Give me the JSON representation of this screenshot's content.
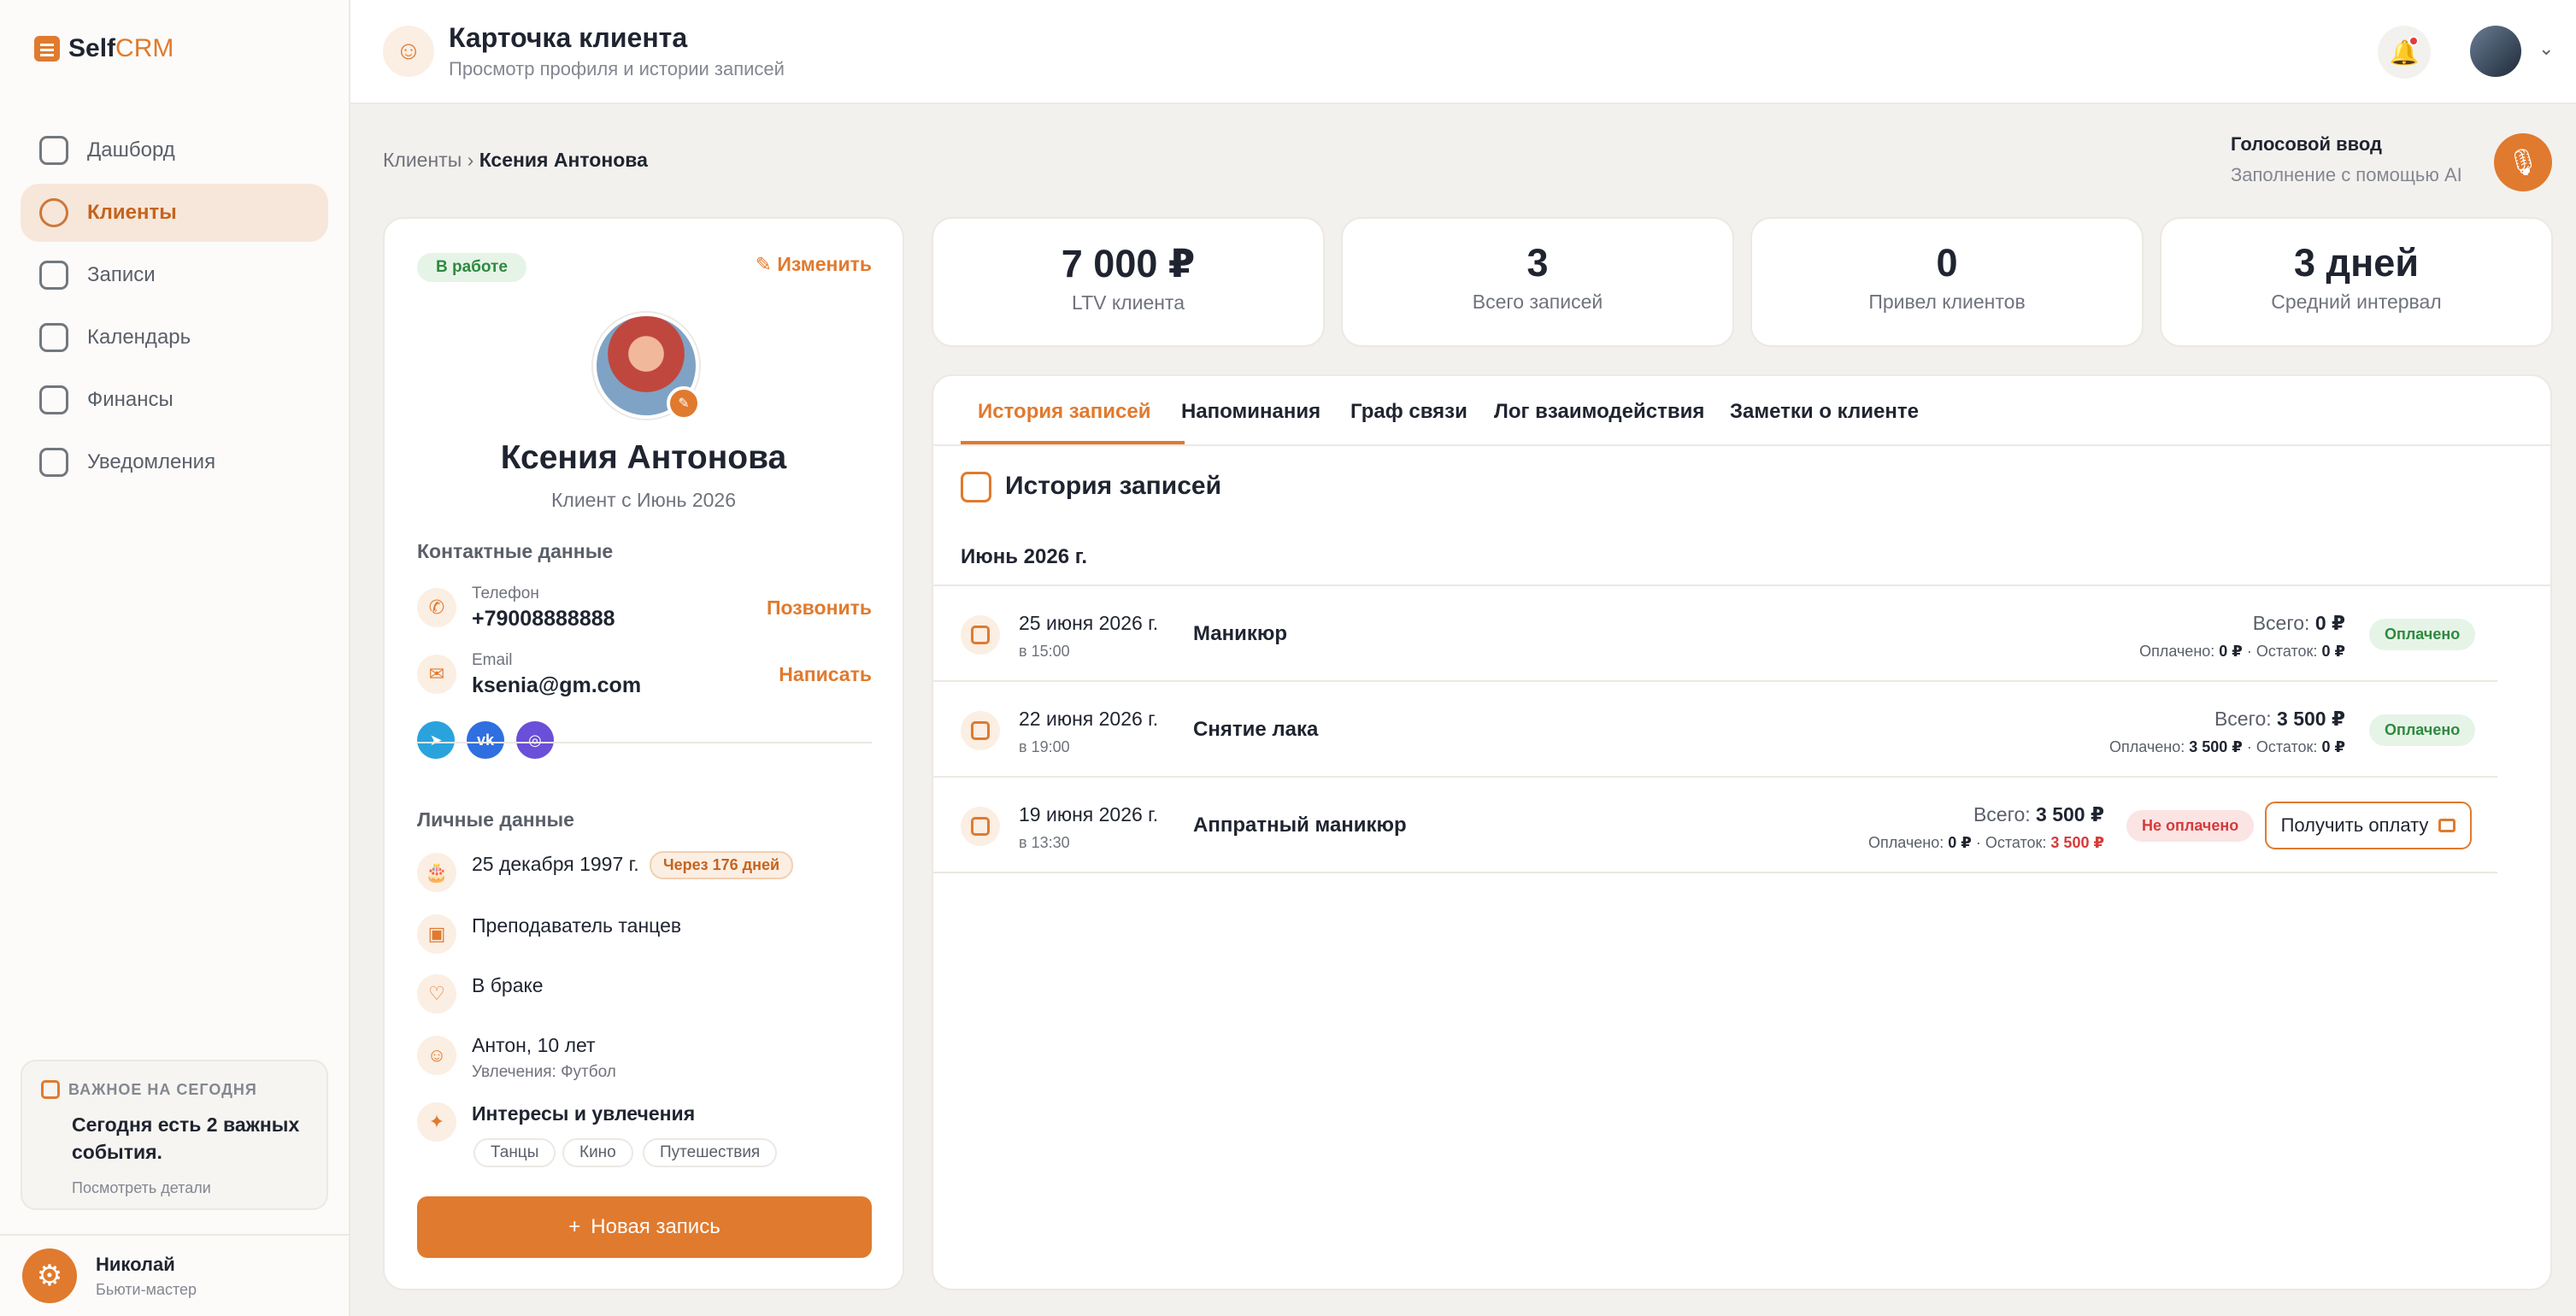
{
  "app": {
    "logo_self": "Self",
    "logo_crm": "CRM"
  },
  "sidebar": {
    "items": [
      {
        "label": "Дашборд"
      },
      {
        "label": "Клиенты"
      },
      {
        "label": "Записи"
      },
      {
        "label": "Календарь"
      },
      {
        "label": "Финансы"
      },
      {
        "label": "Уведомления"
      }
    ],
    "today": {
      "heading": "ВАЖНОЕ НА СЕГОДНЯ",
      "text": "Сегодня есть 2 важных события.",
      "link": "Посмотреть детали"
    },
    "user": {
      "name": "Николай",
      "role": "Бьюти-мастер"
    }
  },
  "header": {
    "title": "Карточка клиента",
    "subtitle": "Просмотр профиля и истории записей"
  },
  "breadcrumb": {
    "parent": "Клиенты",
    "separator": "›",
    "current": "Ксения Антонова"
  },
  "voice": {
    "title": "Голосовой ввод",
    "subtitle": "Заполнение с помощью AI"
  },
  "profile": {
    "status": "В работе",
    "edit": "Изменить",
    "name": "Ксения Антонова",
    "since": "Клиент с Июнь 2026",
    "contacts_title": "Контактные данные",
    "phone_label": "Телефон",
    "phone": "+79008888888",
    "call": "Позвонить",
    "email_label": "Email",
    "email": "ksenia@gm.com",
    "write": "Написать",
    "personal_title": "Личные данные",
    "birthday": "25 декабря 1997 г.",
    "birthday_badge": "Через 176 дней",
    "job": "Преподаватель танцев",
    "family": "В браке",
    "child": "Антон, 10 лет",
    "child_hobby": "Увлечения: Футбол",
    "interests_title": "Интересы и увлечения",
    "tags": [
      "Танцы",
      "Кино",
      "Путешествия"
    ],
    "new_record": "Новая запись"
  },
  "stats": [
    {
      "value": "7 000 ₽",
      "label": "LTV клиента"
    },
    {
      "value": "3",
      "label": "Всего записей"
    },
    {
      "value": "0",
      "label": "Привел клиентов"
    },
    {
      "value": "3 дней",
      "label": "Средний интервал"
    }
  ],
  "tabs": [
    "История записей",
    "Напоминания",
    "Граф связи",
    "Лог взаимодействия",
    "Заметки о клиенте"
  ],
  "history": {
    "title": "История записей",
    "month": "Июнь 2026 г.",
    "total_label": "Всего:",
    "paid_label": "Оплачено:",
    "rest_label": "Остаток:",
    "records": [
      {
        "date": "25 июня 2026 г.",
        "time": "в 15:00",
        "service": "Маникюр",
        "total": "0 ₽",
        "paid": "0 ₽",
        "rest": "0 ₽",
        "status": "Оплачено"
      },
      {
        "date": "22 июня 2026 г.",
        "time": "в 19:00",
        "service": "Снятие лака",
        "total": "3 500 ₽",
        "paid": "3 500 ₽",
        "rest": "0 ₽",
        "status": "Оплачено"
      },
      {
        "date": "19 июня 2026 г.",
        "time": "в 13:30",
        "service": "Аппратный маникюр",
        "total": "3 500 ₽",
        "paid": "0 ₽",
        "rest": "3 500 ₽",
        "status": "Не оплачено",
        "action": "Получить оплату"
      }
    ]
  },
  "colors": {
    "accent": "#e07a2e",
    "paid": "#2f8a3f",
    "unpaid": "#d63a3a"
  }
}
